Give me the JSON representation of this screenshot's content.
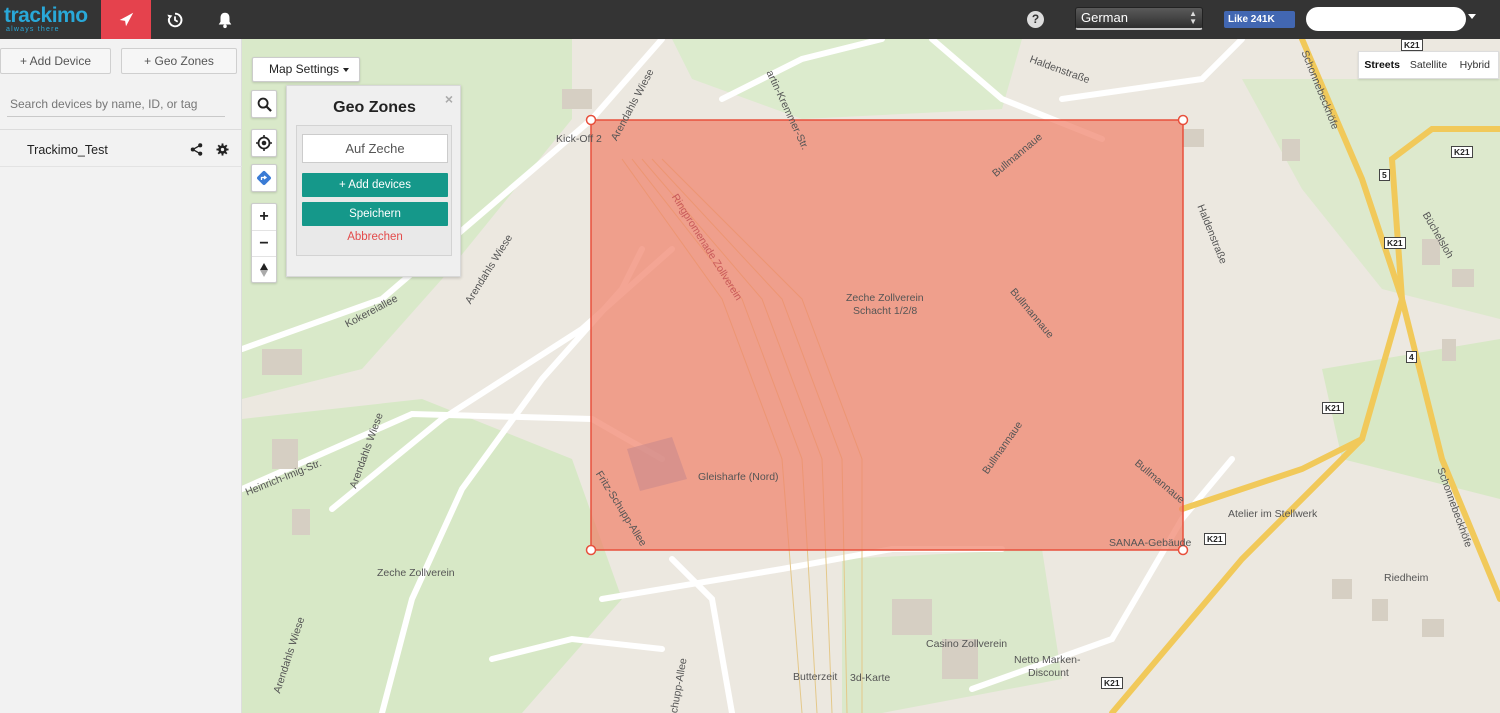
{
  "app": {
    "logo_text": "trackimo",
    "logo_tagline": "always there",
    "accent_color": "#e5424d",
    "brand_color": "#29a8d8"
  },
  "topbar": {
    "nav_icons": [
      "navigation-arrow-icon",
      "history-icon",
      "bell-icon"
    ],
    "help_label": "?",
    "language": "German",
    "fb_like_label": "Like 241K"
  },
  "sidebar": {
    "add_device_label": "+ Add Device",
    "geo_zones_label": "+ Geo Zones",
    "search_placeholder": "Search devices by name, ID, or tag",
    "devices": [
      {
        "name": "Trackimo_Test"
      }
    ]
  },
  "map": {
    "settings_label": "Map Settings",
    "type_buttons": [
      "Streets",
      "Satellite",
      "Hybrid"
    ],
    "active_type": "Streets",
    "zoom_in_label": "+",
    "zoom_out_label": "−",
    "zone_fill_color": "#f08a6e",
    "zone_stroke_color": "#e8503c",
    "labels": {
      "kick_off": "Kick-Off 2",
      "zeche_zollverein_schacht_1": "Zeche Zollverein",
      "zeche_zollverein_schacht_2": "Schacht 1/2/8",
      "gleisharfe": "Gleisharfe (Nord)",
      "sanaa": "SANAA-Gebäude",
      "atelier": "Atelier im Stellwerk",
      "riedheim": "Riedheim",
      "zeche_zollverein_park": "Zeche Zollverein",
      "casino": "Casino Zollverein",
      "netto_1": "Netto Marken-",
      "netto_2": "Discount",
      "butterzeit": "Butterzeit",
      "karte_3d": "3d-Karte"
    },
    "roads": {
      "haldenstrasse_top": "Haldenstraße",
      "haldenstrasse_side": "Haldenstraße",
      "martin_kremmer": "artin-Kremmer-Str.",
      "arendahls_wiese_top": "Arendahls Wiese",
      "arendahls_wiese_mid": "Arendahls Wiese",
      "arendahls_wiese_low": "Arendahls Wiese",
      "arendahls_wiese_bottom": "Arendahls Wiese",
      "kokereiallee": "Kokereiallee",
      "heinrich_imig": "Heinrich-Imig-Str.",
      "fritz_schupp": "Fritz-Schupp-Allee",
      "schupp_allee": "chupp-Allee",
      "bullmannaue_1": "Bullmannaue",
      "bullmannaue_2": "Bullmannaue",
      "bullmannaue_3": "Bullmannaue",
      "bullmannaue_4": "Bullmannaue",
      "schonnebeckhoefe_1": "Schonnebeckhöfe",
      "schonnebeckhoefe_2": "Schonnebeckhöfe",
      "buechelsloh": "Büchelsloh",
      "ringpromenade": "Ringpromenade Zollverein"
    },
    "shields": [
      "K21",
      "K21",
      "K21",
      "K21",
      "K21",
      "K21",
      "5",
      "4"
    ]
  },
  "geo_zone_panel": {
    "title": "Geo Zones",
    "close_label": "×",
    "zone_name_placeholder": "Auf Zeche",
    "add_devices_label": "+ Add devices",
    "save_label": "Speichern",
    "cancel_label": "Abbrechen"
  }
}
